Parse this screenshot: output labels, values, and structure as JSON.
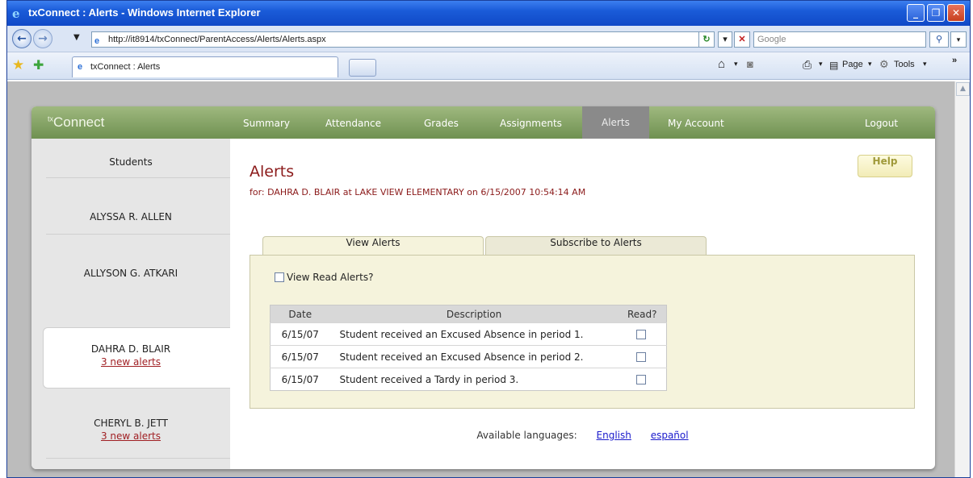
{
  "window": {
    "title": "txConnect : Alerts - Windows Internet Explorer",
    "controls": [
      "minimize",
      "restore",
      "close"
    ]
  },
  "browser": {
    "url": "http://it8914/txConnect/ParentAccess/Alerts/Alerts.aspx",
    "search_placeholder": "Google",
    "tab_title": "txConnect : Alerts",
    "menu": {
      "page": "Page",
      "tools": "Tools"
    }
  },
  "app": {
    "logo": {
      "sup": "tx",
      "text": "Connect"
    },
    "nav": [
      "Summary",
      "Attendance",
      "Grades",
      "Assignments",
      "Alerts",
      "My Account"
    ],
    "active_nav": "Alerts",
    "logout": "Logout"
  },
  "sidebar": {
    "header": "Students",
    "students": [
      {
        "name": "ALYSSA R. ALLEN",
        "alerts": ""
      },
      {
        "name": "ALLYSON G. ATKARI",
        "alerts": ""
      },
      {
        "name": "DAHRA D. BLAIR",
        "alerts": "3 new alerts",
        "selected": true
      },
      {
        "name": "CHERYL B. JETT",
        "alerts": "3 new alerts"
      }
    ]
  },
  "main": {
    "title": "Alerts",
    "for_line": "for: DAHRA D. BLAIR at LAKE VIEW ELEMENTARY on 6/15/2007 10:54:14 AM",
    "help": "Help",
    "tabs": [
      "View Alerts",
      "Subscribe to Alerts"
    ],
    "view_read_label": "View Read Alerts?",
    "table": {
      "headers": [
        "Date",
        "Description",
        "Read?"
      ],
      "rows": [
        {
          "date": "6/15/07",
          "description": "Student received an Excused Absence in period 1."
        },
        {
          "date": "6/15/07",
          "description": "Student received an Excused Absence in period 2."
        },
        {
          "date": "6/15/07",
          "description": "Student received a Tardy in period 3."
        }
      ]
    },
    "languages_label": "Available languages:",
    "languages": [
      "English",
      "español"
    ]
  }
}
